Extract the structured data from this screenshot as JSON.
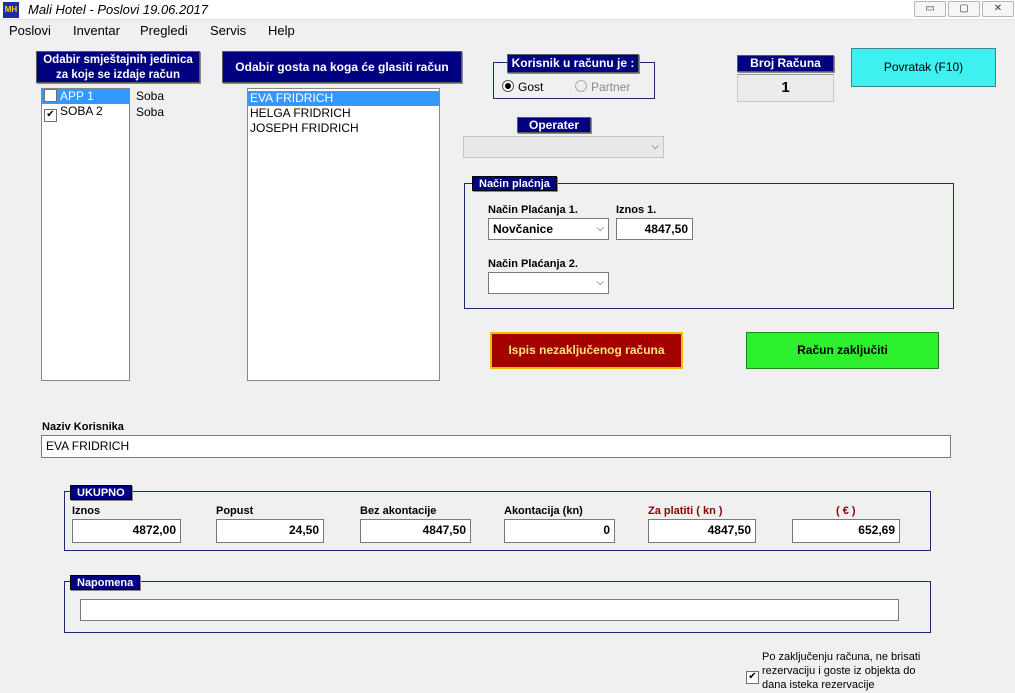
{
  "window": {
    "title": "Mali Hotel - Poslovi 19.06.2017",
    "icon_text": "MH",
    "min_glyph": "▭",
    "max_glyph": "▢",
    "close_glyph": "✕"
  },
  "menu": [
    {
      "label": "Poslovi"
    },
    {
      "label": "Inventar"
    },
    {
      "label": "Pregledi"
    },
    {
      "label": "Servis"
    },
    {
      "label": "Help"
    }
  ],
  "units_panel": {
    "header_line1": "Odabir smještajnih jedinica",
    "header_line2": "za koje se izdaje račun",
    "items": [
      {
        "label": "APP 1",
        "checked": false,
        "selected": true,
        "type": "Soba"
      },
      {
        "label": "SOBA 2",
        "checked": true,
        "selected": false,
        "type": "Soba"
      }
    ]
  },
  "guests_panel": {
    "header": "Odabir gosta na koga će glasiti račun",
    "items": [
      {
        "label": "EVA FRIDRICH",
        "selected": true
      },
      {
        "label": "HELGA FRIDRICH",
        "selected": false
      },
      {
        "label": "JOSEPH FRIDRICH",
        "selected": false
      }
    ]
  },
  "user_type": {
    "header": "Korisnik u računu je :",
    "options": [
      {
        "label": "Gost",
        "selected": true,
        "enabled": true
      },
      {
        "label": "Partner",
        "selected": false,
        "enabled": false
      }
    ]
  },
  "operater": {
    "header": "Operater",
    "value": ""
  },
  "invoice_number": {
    "header": "Broj Računa",
    "value": "1"
  },
  "back_button": {
    "label": "Povratak (F10)"
  },
  "payment": {
    "header": "Način plaćnja",
    "method1_label": "Način Plaćanja 1.",
    "method1_value": "Novčanice",
    "amount1_label": "Iznos 1.",
    "amount1_value": "4847,50",
    "method2_label": "Način Plaćanja 2.",
    "method2_value": ""
  },
  "actions": {
    "print_unclosed": "Ispis nezaključenog računa",
    "close_invoice": "Račun zaključiti"
  },
  "customer_name": {
    "label": "Naziv Korisnika",
    "value": "EVA FRIDRICH"
  },
  "totals": {
    "header": "UKUPNO",
    "fields": [
      {
        "label": "Iznos",
        "value": "4872,00",
        "red": false
      },
      {
        "label": "Popust",
        "value": "24,50",
        "red": false
      },
      {
        "label": "Bez akontacije",
        "value": "4847,50",
        "red": false
      },
      {
        "label": "Akontacija (kn)",
        "value": "0",
        "red": false
      },
      {
        "label": "Za platiti ( kn )",
        "value": "4847,50",
        "red": true
      },
      {
        "label": "( € )",
        "value": "652,69",
        "red": true
      }
    ]
  },
  "note": {
    "header": "Napomena",
    "value": ""
  },
  "keep_option": {
    "checked": true,
    "line1": "Po zaključenju računa, ne brisati",
    "line2": "rezervaciju i goste iz objekta do",
    "line3": "dana isteka rezervacije"
  },
  "colors": {
    "navy": "#000080",
    "back_button": "#3ff0f0",
    "print_button": "#a40000",
    "close_button": "#2df02d"
  }
}
